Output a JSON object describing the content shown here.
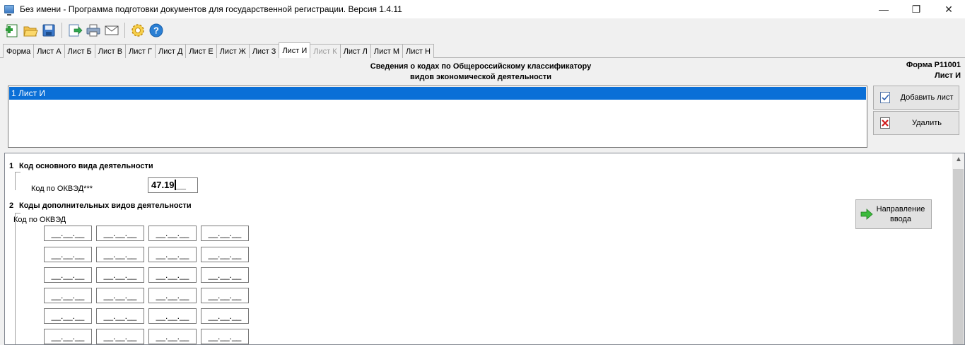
{
  "window": {
    "title": "Без имени - Программа подготовки документов для государственной регистрации. Версия 1.4.11",
    "controls": [
      "—",
      "❐",
      "✕"
    ]
  },
  "toolbar": {
    "icons": [
      "new-document-icon",
      "open-folder-icon",
      "save-icon",
      "export-icon",
      "print-icon",
      "mail-icon",
      "settings-icon",
      "help-icon"
    ]
  },
  "tabs": [
    {
      "label": "Форма",
      "state": "normal"
    },
    {
      "label": "Лист А",
      "state": "normal"
    },
    {
      "label": "Лист Б",
      "state": "normal"
    },
    {
      "label": "Лист В",
      "state": "normal"
    },
    {
      "label": "Лист Г",
      "state": "normal"
    },
    {
      "label": "Лист Д",
      "state": "normal"
    },
    {
      "label": "Лист Е",
      "state": "normal"
    },
    {
      "label": "Лист Ж",
      "state": "normal"
    },
    {
      "label": "Лист З",
      "state": "normal"
    },
    {
      "label": "Лист И",
      "state": "active"
    },
    {
      "label": "Лист К",
      "state": "disabled"
    },
    {
      "label": "Лист Л",
      "state": "normal"
    },
    {
      "label": "Лист М",
      "state": "normal"
    },
    {
      "label": "Лист Н",
      "state": "normal"
    }
  ],
  "header": {
    "title_line1": "Сведения о кодах по Общероссийскому классификатору",
    "title_line2": "видов экономической деятельности",
    "form_code": "Форма Р11001",
    "sheet_name": "Лист И"
  },
  "sheets": {
    "items": [
      "1 Лист И"
    ],
    "add_label": "Добавить лист",
    "delete_label": "Удалить"
  },
  "section1": {
    "num": "1",
    "title": "Код основного вида деятельности",
    "field_label": "Код по ОКВЭД***",
    "value": "47.19"
  },
  "section2": {
    "num": "2",
    "title": "Коды дополнительных видов деятельности",
    "field_label": "Код по ОКВЭД",
    "placeholder": "__.__.__",
    "direction_button": "Направление ввода"
  },
  "colors": {
    "selection": "#0a6fd7",
    "window_bg": "#f0f0f0",
    "panel_bg": "#ffffff"
  }
}
